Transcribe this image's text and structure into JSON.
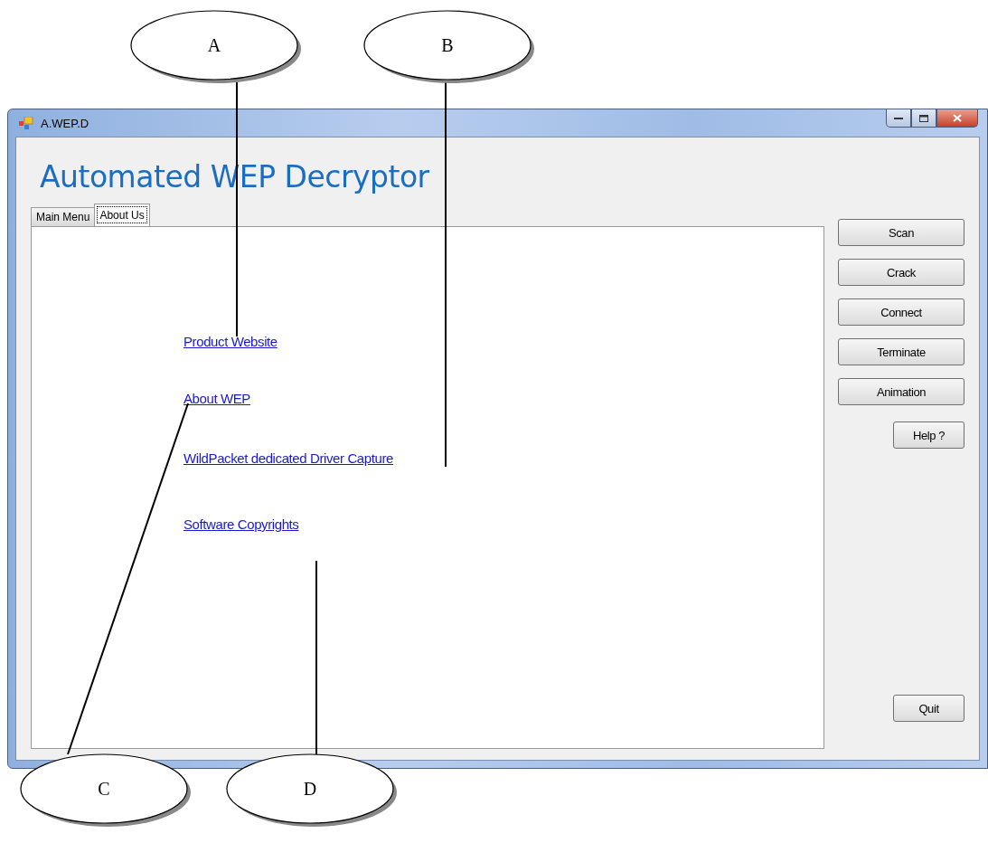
{
  "window": {
    "title": "A.WEP.D",
    "heading": "Automated WEP Decryptor"
  },
  "tabs": [
    {
      "label": "Main Menu",
      "selected": false
    },
    {
      "label": "About Us",
      "selected": true
    }
  ],
  "links": [
    "Product Website",
    "About WEP",
    "WildPacket dedicated Driver Capture",
    "Software Copyrights"
  ],
  "buttons": [
    "Scan",
    "Crack",
    "Connect",
    "Terminate",
    "Animation"
  ],
  "help_button": "Help ?",
  "quit_button": "Quit",
  "callouts": [
    "A",
    "B",
    "C",
    "D"
  ]
}
